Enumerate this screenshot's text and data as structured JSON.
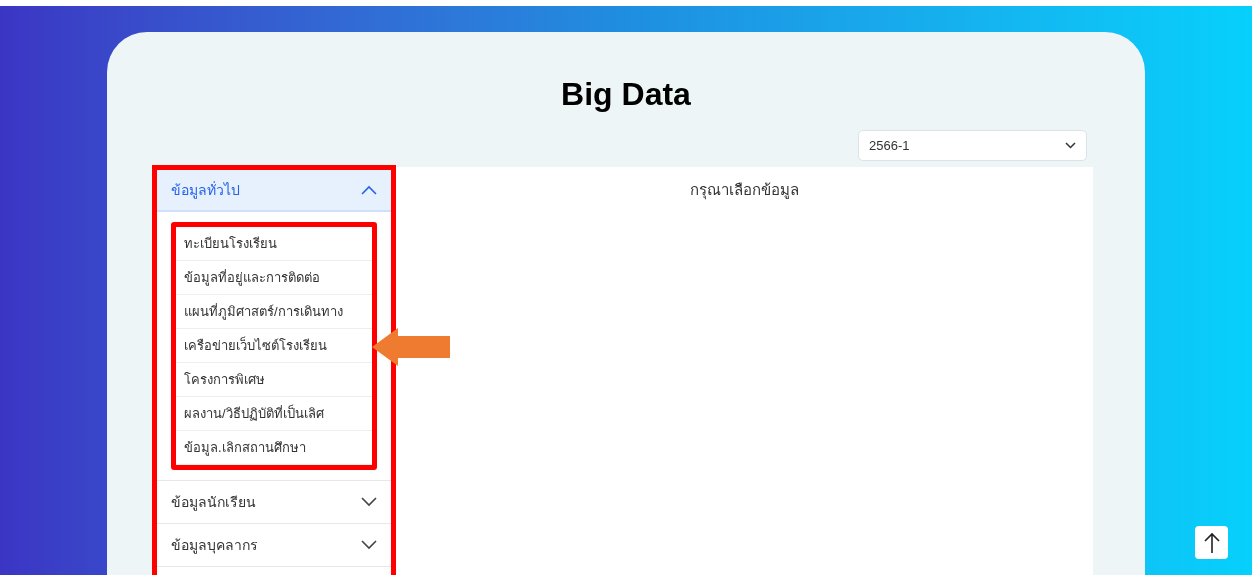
{
  "page": {
    "title": "Big Data"
  },
  "term_select": {
    "value": "2566-1"
  },
  "sidebar": {
    "sections": [
      {
        "label": "ข้อมูลทั่วไป",
        "expanded": true,
        "items": [
          "ทะเบียนโรงเรียน",
          "ข้อมูลที่อยู่และการติดต่อ",
          "แผนที่ภูมิศาสตร์/การเดินทาง",
          "เครือข่ายเว็บไซต์โรงเรียน",
          "โครงการพิเศษ",
          "ผลงาน/วิธีปฏิบัติที่เป็นเลิศ",
          "ข้อมูล.เลิกสถานศึกษา"
        ]
      },
      {
        "label": "ข้อมูลนักเรียน",
        "expanded": false
      },
      {
        "label": "ข้อมูลบุคลากร",
        "expanded": false
      }
    ]
  },
  "main": {
    "message": "กรุณาเลือกข้อมูล"
  }
}
